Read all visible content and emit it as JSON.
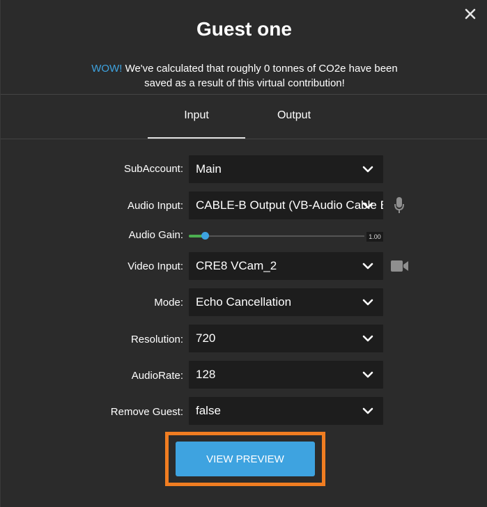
{
  "dialog": {
    "title": "Guest one",
    "notice_highlight": "WOW!",
    "notice_line1": " We've calculated that roughly 0 tonnes of CO2e have been",
    "notice_line2": "saved as a result of this virtual contribution!"
  },
  "tabs": [
    {
      "label": "Input",
      "active": true
    },
    {
      "label": "Output",
      "active": false
    }
  ],
  "form": {
    "subaccount": {
      "label": "SubAccount:",
      "value": "Main"
    },
    "audio_input": {
      "label": "Audio Input:",
      "value": "CABLE-B Output (VB-Audio Cable B)"
    },
    "audio_gain": {
      "label": "Audio Gain:",
      "value": "1.00",
      "level": 0.09
    },
    "video_input": {
      "label": "Video Input:",
      "value": "CRE8 VCam_2"
    },
    "mode": {
      "label": "Mode:",
      "value": "Echo Cancellation"
    },
    "resolution": {
      "label": "Resolution:",
      "value": "720"
    },
    "audio_rate": {
      "label": "AudioRate:",
      "value": "128"
    },
    "remove_guest": {
      "label": "Remove Guest:",
      "value": "false"
    }
  },
  "actions": {
    "view_preview": "VIEW PREVIEW"
  },
  "colors": {
    "accent": "#3ea3e0",
    "highlight_frame": "#f07d21",
    "gain_fill": "#4caf50"
  },
  "icons": {
    "close": "close-icon",
    "microphone": "microphone-icon",
    "video_camera": "video-camera-icon",
    "chevron": "chevron-down-icon"
  }
}
